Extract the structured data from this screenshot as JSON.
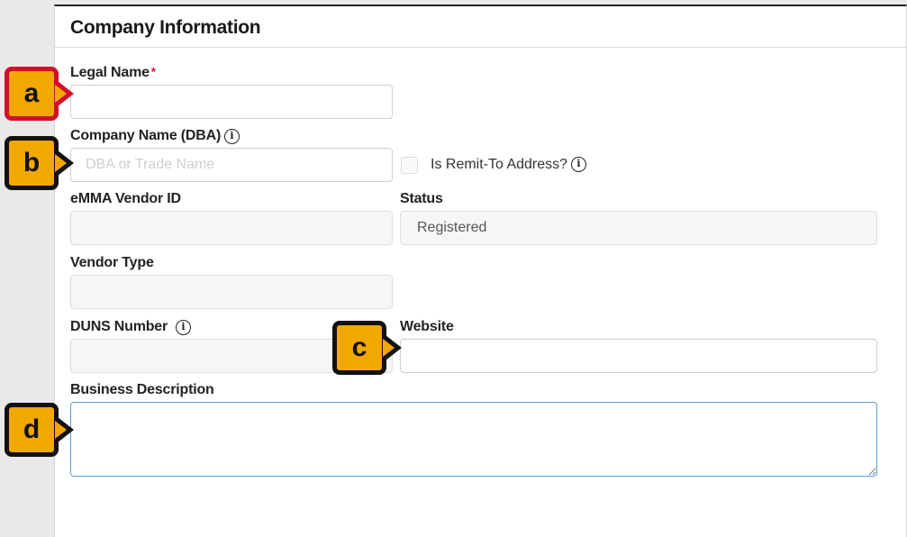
{
  "panel": {
    "title": "Company Information"
  },
  "fields": {
    "legal_name": {
      "label": "Legal Name",
      "required_mark": "*",
      "value": ""
    },
    "dba": {
      "label": "Company Name (DBA)",
      "placeholder": "DBA or Trade Name",
      "value": ""
    },
    "remit_to": {
      "label": "Is Remit-To Address?",
      "checked": false
    },
    "emma_vendor_id": {
      "label": "eMMA Vendor ID",
      "value": ""
    },
    "status": {
      "label": "Status",
      "value": "Registered"
    },
    "vendor_type": {
      "label": "Vendor Type",
      "value": ""
    },
    "duns": {
      "label": "DUNS Number",
      "value": ""
    },
    "website": {
      "label": "Website",
      "value": ""
    },
    "business_description": {
      "label": "Business Description",
      "value": ""
    }
  },
  "info_icon_glyph": "i",
  "callouts": {
    "a": "a",
    "b": "b",
    "c": "c",
    "d": "d"
  },
  "colors": {
    "callout_fill": "#f2a800",
    "callout_border": "#111111",
    "callout_border_active": "#d0102c",
    "required": "#c8102e",
    "focus_border": "#5d9ad3"
  }
}
